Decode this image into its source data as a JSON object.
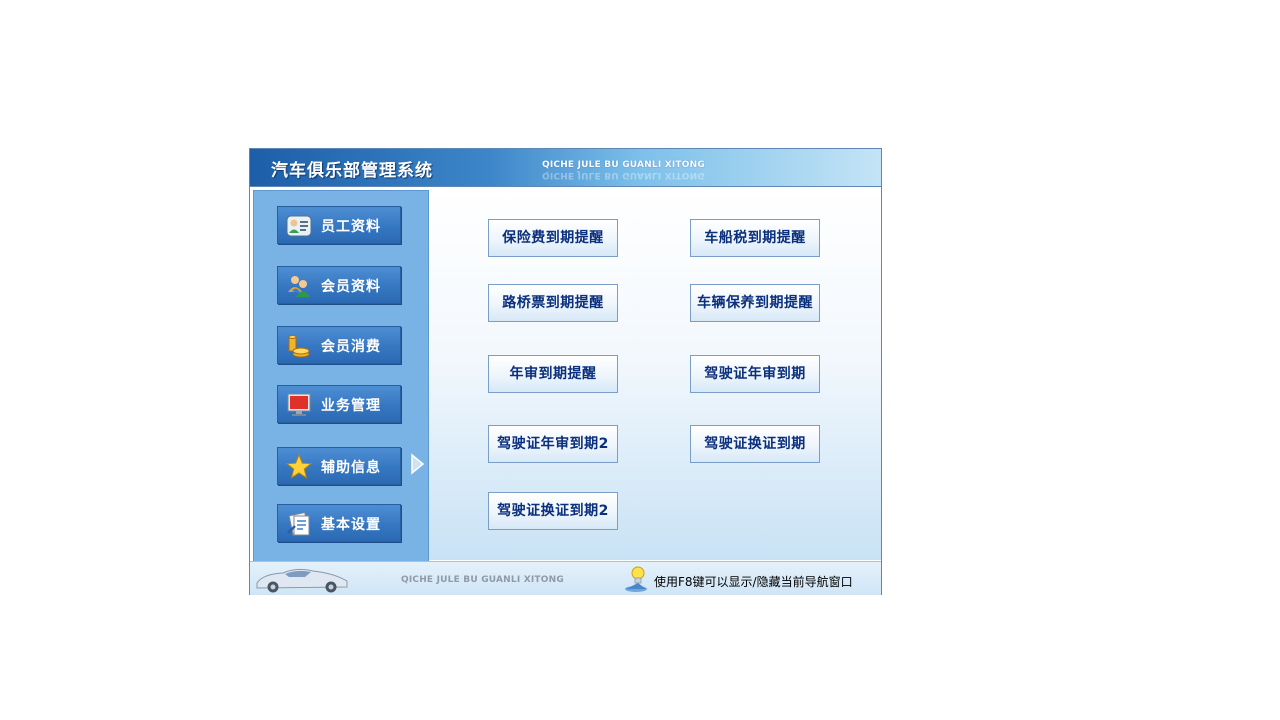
{
  "app": {
    "title": "汽车俱乐部管理系统",
    "subtitle": "QICHE JULE BU GUANLI XITONG"
  },
  "sidebar": {
    "items": [
      {
        "label": "员工资料",
        "icon": "employee-card-icon"
      },
      {
        "label": "会员资料",
        "icon": "members-group-icon"
      },
      {
        "label": "会员消费",
        "icon": "coins-icon"
      },
      {
        "label": "业务管理",
        "icon": "monitor-icon"
      },
      {
        "label": "辅助信息",
        "icon": "star-icon"
      },
      {
        "label": "基本设置",
        "icon": "settings-document-icon"
      }
    ]
  },
  "reminders": [
    "保险费到期提醒",
    "车船税到期提醒",
    "路桥票到期提醒",
    "车辆保养到期提醒",
    "年审到期提醒",
    "驾驶证年审到期",
    "驾驶证年审到期2",
    "驾驶证换证到期",
    "驾驶证换证到期2"
  ],
  "footer": {
    "subtitle": "QICHE JULE BU GUANLI XITONG",
    "hint": "使用F8键可以显示/隐藏当前导航窗口"
  },
  "colors": {
    "title_bar": "#1d5ea8",
    "sidebar_bg": "#79b3e6",
    "nav_button": "#3677c2",
    "reminder_text": "#0a2f7d"
  }
}
